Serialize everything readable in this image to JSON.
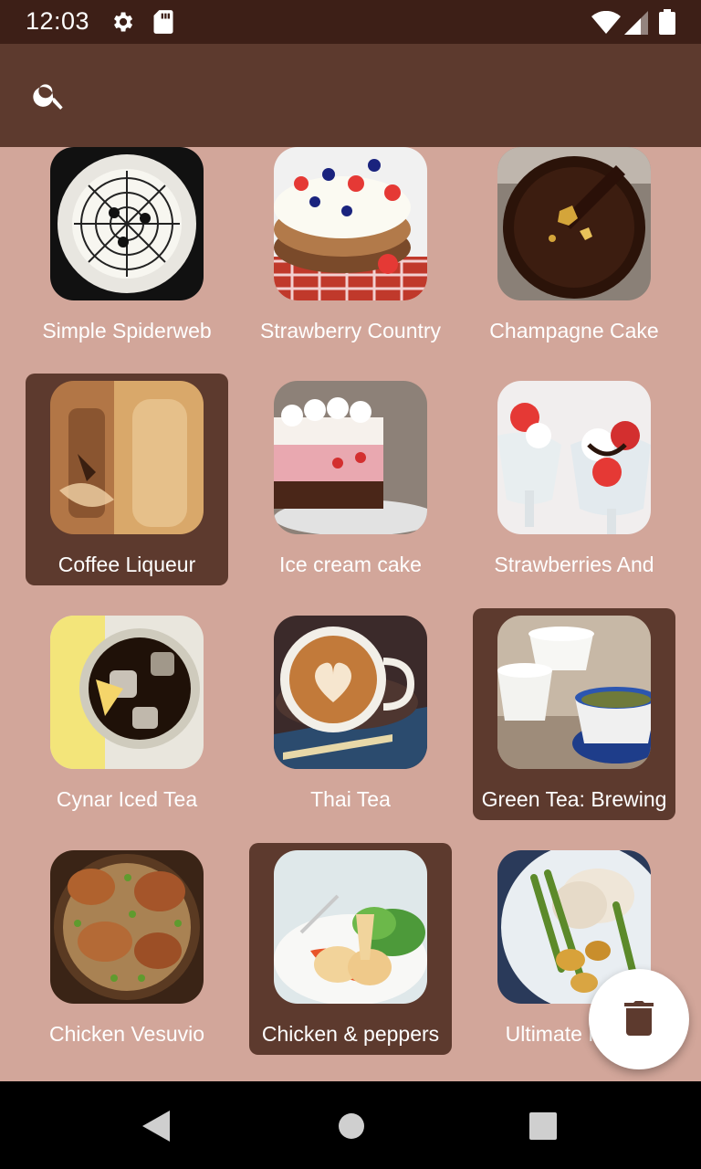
{
  "status_bar": {
    "time": "12:03",
    "icons": [
      "settings-icon",
      "sd-card-icon",
      "wifi-icon",
      "signal-icon",
      "battery-icon"
    ]
  },
  "app_bar": {
    "search_icon": "search-icon"
  },
  "colors": {
    "background": "#d2a69a",
    "app_bar": "#5d3a2e",
    "status_bar": "#3d1f17",
    "selected_tile": "#5d3a2e",
    "label_text": "#ffffff"
  },
  "recipes": [
    {
      "label": "Simple Spiderweb",
      "selected": false
    },
    {
      "label": "Strawberry Country",
      "selected": false
    },
    {
      "label": "Champagne Cake",
      "selected": false
    },
    {
      "label": "Coffee Liqueur",
      "selected": true
    },
    {
      "label": "Ice cream cake",
      "selected": false
    },
    {
      "label": "Strawberries And",
      "selected": false
    },
    {
      "label": "Cynar Iced Tea",
      "selected": false
    },
    {
      "label": "Thai Tea",
      "selected": false
    },
    {
      "label": "Green Tea: Brewing",
      "selected": true
    },
    {
      "label": "Chicken Vesuvio",
      "selected": false
    },
    {
      "label": "Chicken & peppers",
      "selected": true
    },
    {
      "label": "Ultimate Roast",
      "selected": false
    }
  ],
  "fab": {
    "icon": "trash-icon"
  },
  "nav_bar": {
    "icons": [
      "back-icon",
      "home-icon",
      "recents-icon"
    ]
  }
}
